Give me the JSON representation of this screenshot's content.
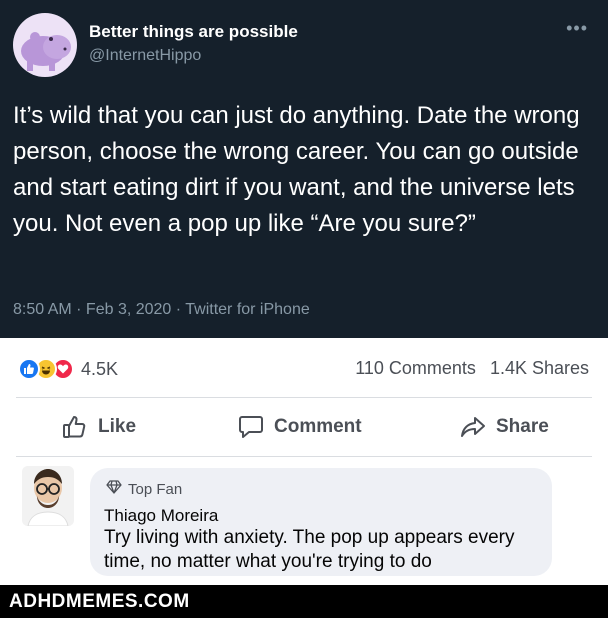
{
  "tweet": {
    "author_name": "Better things are possible",
    "author_handle": "@InternetHippo",
    "more_icon": "more-dots-icon",
    "text": "It’s wild that you can just do anything. Date the wrong person, choose the wrong career. You can go outside and start eating dirt if you want, and the universe lets you. Not even a pop up like “Are you sure?”",
    "meta": "8:50 AM · Feb 3, 2020 · Twitter for iPhone",
    "colors": {
      "background": "#15202b",
      "text": "#ffffff",
      "secondary": "#8899a6"
    }
  },
  "reactions": {
    "icons": [
      "like-reaction-icon",
      "haha-reaction-icon",
      "love-reaction-icon"
    ],
    "count": "4.5K",
    "comments": "110 Comments",
    "shares": "1.4K Shares",
    "colors": {
      "like": "#1877f2",
      "haha": "#f7c531",
      "love": "#f0284a"
    }
  },
  "actions": {
    "like_label": "Like",
    "comment_label": "Comment",
    "share_label": "Share"
  },
  "comment": {
    "badge": "Top Fan",
    "badge_icon": "diamond-icon",
    "author": "Thiago Moreira",
    "text": "Try living with anxiety. The pop up appears every time, no matter what you're trying to do"
  },
  "footer": {
    "watermark": "ADHDMEMES.COM"
  }
}
